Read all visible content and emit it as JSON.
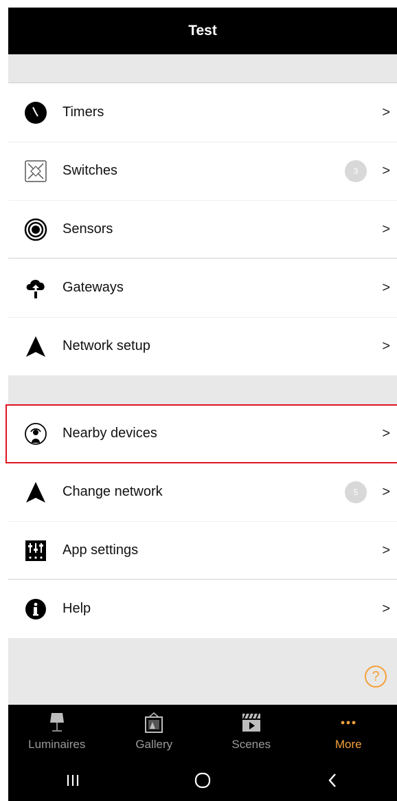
{
  "header": {
    "title": "Test"
  },
  "menu_groups": [
    {
      "items": [
        {
          "label": "Timers",
          "icon": "clock-icon",
          "chevron": ">"
        },
        {
          "label": "Switches",
          "icon": "switch-icon",
          "badge": "3",
          "chevron": ">"
        },
        {
          "label": "Sensors",
          "icon": "sensor-icon",
          "chevron": ">"
        }
      ]
    },
    {
      "items": [
        {
          "label": "Gateways",
          "icon": "cloud-upload-icon",
          "chevron": ">"
        },
        {
          "label": "Network setup",
          "icon": "network-arrow-icon",
          "chevron": ">"
        }
      ]
    },
    {
      "items": [
        {
          "label": "Nearby devices",
          "icon": "nearby-devices-icon",
          "chevron": ">",
          "highlighted": true
        },
        {
          "label": "Change network",
          "icon": "network-arrow-icon",
          "badge": "5",
          "chevron": ">"
        },
        {
          "label": "App settings",
          "icon": "sliders-icon",
          "chevron": ">"
        }
      ]
    },
    {
      "items": [
        {
          "label": "Help",
          "icon": "info-icon",
          "chevron": ">"
        }
      ]
    }
  ],
  "help_button": {
    "glyph": "?",
    "icon": "question-circle-icon"
  },
  "tabs": [
    {
      "label": "Luminaires",
      "icon": "lamp-icon",
      "active": false
    },
    {
      "label": "Gallery",
      "icon": "gallery-icon",
      "active": false
    },
    {
      "label": "Scenes",
      "icon": "clapperboard-icon",
      "active": false
    },
    {
      "label": "More",
      "icon": "more-dots-icon",
      "active": true
    }
  ],
  "system_nav": [
    {
      "icon": "recent-apps-icon"
    },
    {
      "icon": "home-icon"
    },
    {
      "icon": "back-icon"
    }
  ],
  "colors": {
    "accent": "#f5a03a",
    "highlight_border": "#e0141e",
    "header_bg": "#000000",
    "section_gap": "#e8e8e8",
    "badge_bg": "#d8d8d8"
  }
}
